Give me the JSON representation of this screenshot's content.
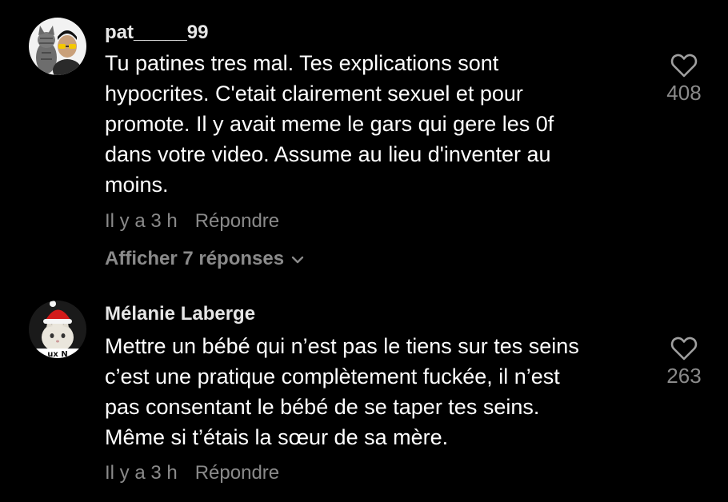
{
  "comments": [
    {
      "username": "pat_____99",
      "lines": [
        "Tu patines tres mal. Tes explications sont",
        "hypocrites. C'etait clairement sexuel et pour",
        "promote. Il y avait meme le gars qui gere les 0f",
        "dans votre video. Assume au lieu d'inventer au",
        "moins."
      ],
      "time": "Il y a 3 h",
      "reply_label": "Répondre",
      "view_replies": "Afficher 7 réponses",
      "likes": "408",
      "avatar_icon": "cat-and-man-avatar"
    },
    {
      "username": "Mélanie Laberge",
      "lines": [
        "Mettre un bébé qui n’est pas le tiens sur tes seins",
        "c’est une pratique complètement fuckée, il n’est",
        "pas consentant le bébé de se taper tes seins.",
        "Même si t’étais la sœur de sa mère."
      ],
      "time": "Il y a 3 h",
      "reply_label": "Répondre",
      "likes": "263",
      "avatar_icon": "cat-santa-hat-avatar",
      "avatar_text": "ux N"
    }
  ],
  "colors": {
    "background": "#000000",
    "text": "#ffffff",
    "muted": "#8a8a8a"
  }
}
